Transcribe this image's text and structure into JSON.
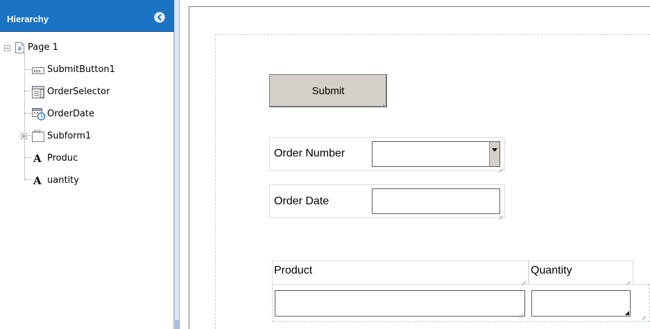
{
  "hierarchy": {
    "title": "Hierarchy",
    "collapse_icon": "chevron-left-circle-icon",
    "nodes": [
      {
        "label": "Page 1",
        "icon": "page-icon",
        "expander": "minus"
      },
      {
        "label": "SubmitButton1",
        "icon": "button-field-icon"
      },
      {
        "label": "OrderSelector",
        "icon": "dropdown-list-icon"
      },
      {
        "label": "OrderDate",
        "icon": "date-time-field-icon"
      },
      {
        "label": "Subform1",
        "icon": "subform-icon",
        "expander": "plus"
      },
      {
        "label": "Produc",
        "icon": "text-object-icon"
      },
      {
        "label": "uantity",
        "icon": "text-object-icon"
      }
    ]
  },
  "form": {
    "submit_label": "Submit",
    "order_number_label": "Order Number",
    "order_number_value": "",
    "order_date_label": "Order Date",
    "order_date_value": "",
    "table": {
      "columns": [
        "Product",
        "Quantity"
      ],
      "row": [
        "",
        ""
      ]
    }
  },
  "colors": {
    "header_bg": "#1b73c4",
    "button_face": "#d4d0c8"
  }
}
